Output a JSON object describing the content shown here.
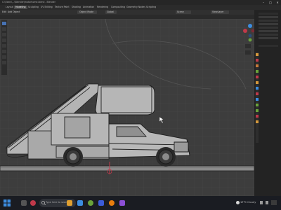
{
  "window": {
    "title": "C:\\Users\\...\\Blender\\motorhome.blend - Blender",
    "controls": [
      "–",
      "□",
      "✕"
    ]
  },
  "workspaces": [
    {
      "label": "Layout",
      "active": false
    },
    {
      "label": "Modeling",
      "active": true
    },
    {
      "label": "Sculpting",
      "active": false
    },
    {
      "label": "UV Editing",
      "active": false
    },
    {
      "label": "Texture Paint",
      "active": false
    },
    {
      "label": "Shading",
      "active": false
    },
    {
      "label": "Animation",
      "active": false
    },
    {
      "label": "Rendering",
      "active": false
    },
    {
      "label": "Compositing",
      "active": false
    },
    {
      "label": "Geometry Nodes",
      "active": false
    },
    {
      "label": "Scripting",
      "active": false
    }
  ],
  "viewport_header": {
    "menu": [
      "Edit",
      "Add",
      "Object"
    ],
    "mode": "Object Mode",
    "view": "Global",
    "scene": "Scene",
    "view_layer": "ViewLayer"
  },
  "taskbar": {
    "search_placeholder": "Type here to search",
    "weather_temp": "17°C",
    "weather_cond": "Cloudy"
  },
  "colors": {
    "viewport_bg": "#3d3d3d",
    "grid": "#474747",
    "mesh_fill": "#b4b4b4",
    "mesh_wire": "#1e1e1e",
    "axis_red": "#c0394a",
    "accent": "#4772b3"
  }
}
